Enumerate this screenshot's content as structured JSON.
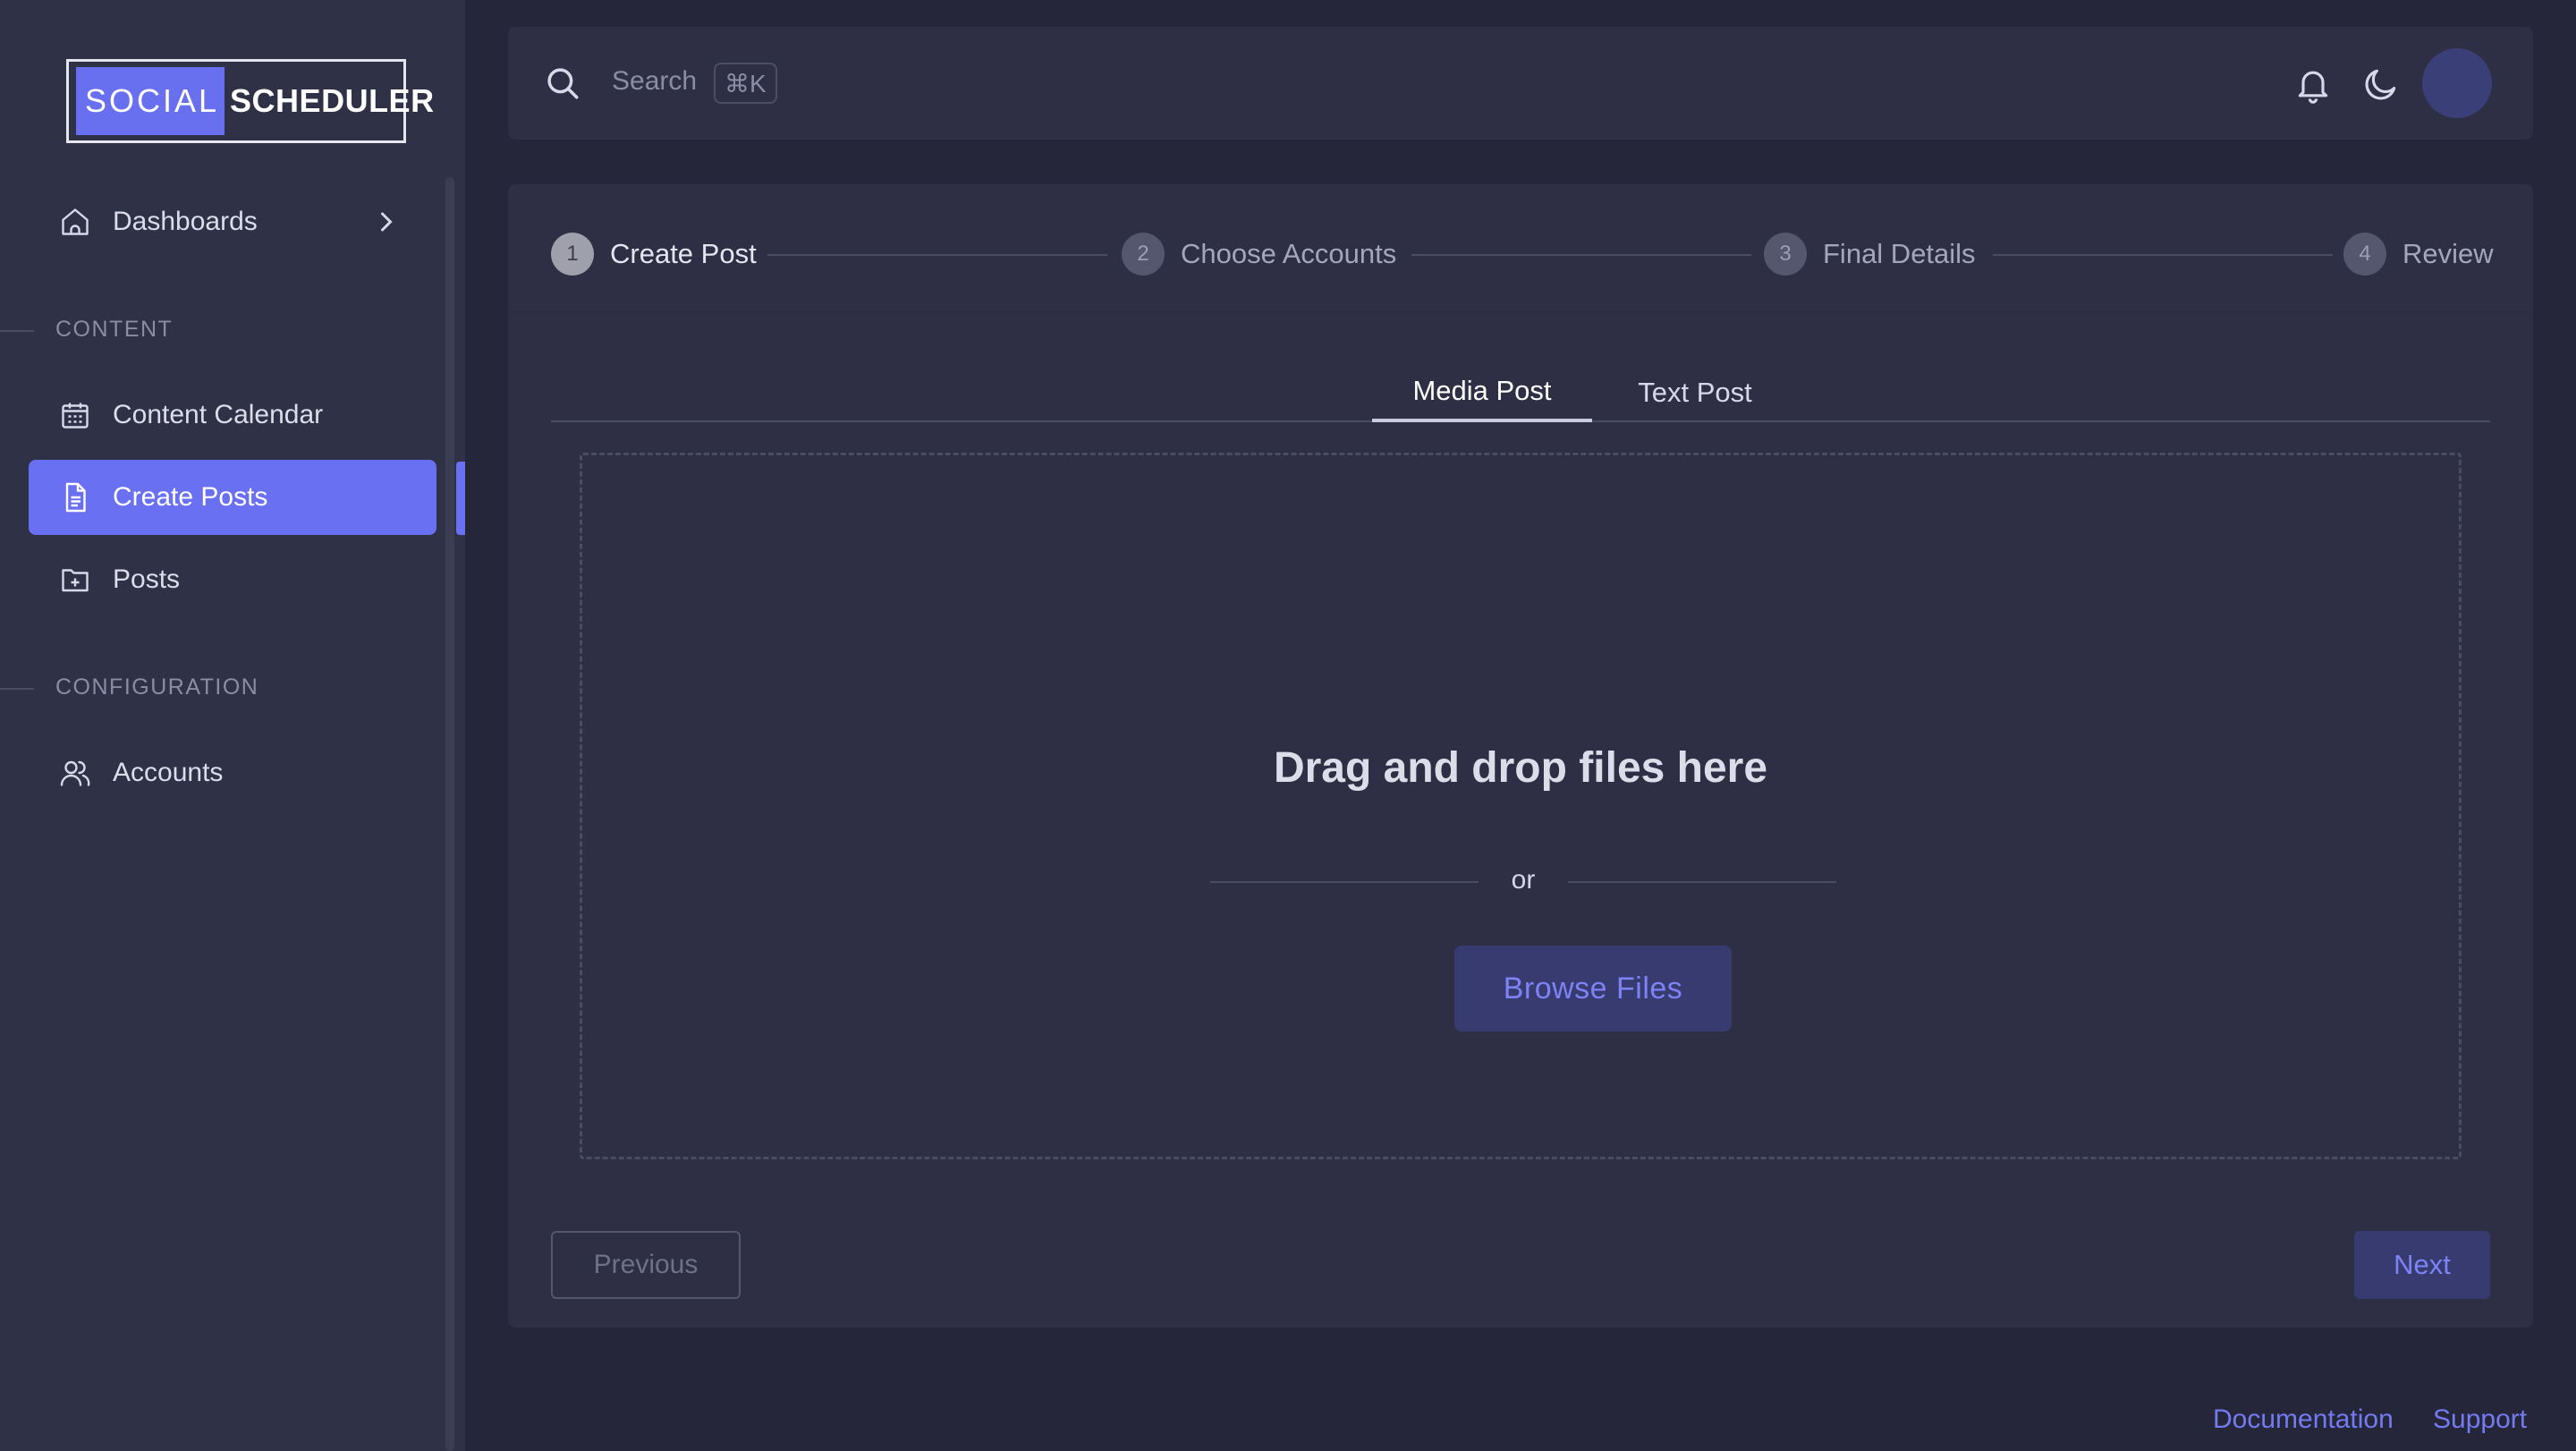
{
  "brand": {
    "part1": "SOCIAL",
    "part2": "SCHEDULER"
  },
  "sidebar": {
    "top_items": [
      {
        "label": "Dashboards",
        "icon": "home-icon"
      }
    ],
    "sections": [
      {
        "title": "CONTENT",
        "items": [
          {
            "label": "Content Calendar",
            "icon": "calendar-icon"
          },
          {
            "label": "Create Posts",
            "icon": "document-icon",
            "active": true
          },
          {
            "label": "Posts",
            "icon": "folder-plus-icon"
          }
        ]
      },
      {
        "title": "CONFIGURATION",
        "items": [
          {
            "label": "Accounts",
            "icon": "users-icon"
          }
        ]
      }
    ]
  },
  "topbar": {
    "search_placeholder": "Search",
    "shortcut": "⌘K"
  },
  "stepper": {
    "steps": [
      {
        "num": "1",
        "label": "Create Post",
        "current": true
      },
      {
        "num": "2",
        "label": "Choose Accounts"
      },
      {
        "num": "3",
        "label": "Final Details"
      },
      {
        "num": "4",
        "label": "Review"
      }
    ]
  },
  "tabs": [
    {
      "label": "Media Post",
      "active": true
    },
    {
      "label": "Text Post"
    }
  ],
  "dropzone": {
    "title": "Drag and drop files here",
    "or": "or",
    "browse_label": "Browse Files"
  },
  "actions": {
    "previous": "Previous",
    "next": "Next"
  },
  "footer": {
    "documentation": "Documentation",
    "support": "Support"
  },
  "colors": {
    "accent": "#6a70f2",
    "background": "#25263a",
    "panel": "#2e2f45"
  }
}
